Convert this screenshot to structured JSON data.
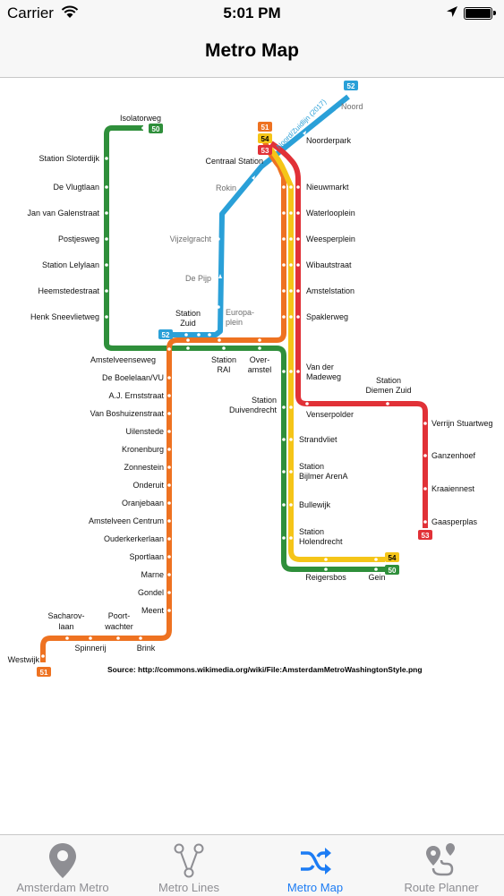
{
  "status_bar": {
    "carrier": "Carrier",
    "time": "5:01 PM",
    "battery_level": 1.0
  },
  "nav": {
    "title": "Metro Map"
  },
  "colors": {
    "line50": "#2f8f3b",
    "line51": "#ee7221",
    "line52": "#2aa0d8",
    "line53": "#e13137",
    "line54": "#f5c518",
    "active_tab": "#1c7cf4",
    "inactive_tab": "#8e8e93"
  },
  "map": {
    "source": "Source: http://commons.wikimedia.org/wiki/File:AmsterdamMetroWashingtonStyle.png",
    "construction_label": "Noord/Zuidlijn (2017)",
    "badges": {
      "b50": "50",
      "b51": "51",
      "b52": "52",
      "b53": "53",
      "b54": "54"
    },
    "stations": {
      "isolatorweg": "Isolatorweg",
      "sloterdijk": "Station Sloterdijk",
      "vlugtlaan": "De Vlugtlaan",
      "galenstraat": "Jan van Galenstraat",
      "postjesweg": "Postjesweg",
      "lelylaan": "Station Lelylaan",
      "heemstedestraat": "Heemstedestraat",
      "sneevlietweg": "Henk Sneevlietweg",
      "amstelveenseweg": "Amstelveenseweg",
      "boelelaan": "De Boelelaan/VU",
      "ernststraat": "A.J. Ernststraat",
      "boshuizenstraat": "Van Boshuizenstraat",
      "uilenstede": "Uilenstede",
      "kronenburg": "Kronenburg",
      "zonnestein": "Zonnestein",
      "onderuit": "Onderuit",
      "oranjebaan": "Oranjebaan",
      "amstelveen_centrum": "Amstelveen Centrum",
      "ouderkerkerlaan": "Ouderkerkerlaan",
      "sportlaan": "Sportlaan",
      "marne": "Marne",
      "gondel": "Gondel",
      "meent": "Meent",
      "sacharovlaan_1": "Sacharov-",
      "sacharovlaan_2": "laan",
      "poortwachter_1": "Poort-",
      "poortwachter_2": "wachter",
      "spinnerij": "Spinnerij",
      "brink": "Brink",
      "westwijk": "Westwijk",
      "noord": "Noord",
      "noorderpark": "Noorderpark",
      "centraal": "Centraal Station",
      "rokin": "Rokin",
      "vijzelgracht": "Vijzelgracht",
      "de_pijp": "De Pijp",
      "zuid_1": "Station",
      "zuid_2": "Zuid",
      "europaplein_1": "Europa-",
      "europaplein_2": "plein",
      "rai_1": "Station",
      "rai_2": "RAI",
      "overamstel_1": "Over-",
      "overamstel_2": "amstel",
      "nieuwmarkt": "Nieuwmarkt",
      "waterlooplein": "Waterlooplein",
      "weesperplein": "Weesperplein",
      "wibautstraat": "Wibautstraat",
      "amstelstation": "Amstelstation",
      "spaklerweg": "Spaklerweg",
      "madeweg_1": "Van der",
      "madeweg_2": "Madeweg",
      "duivendrecht_1": "Station",
      "duivendrecht_2": "Duivendrecht",
      "diemen_1": "Station",
      "diemen_2": "Diemen Zuid",
      "venserpolder": "Venserpolder",
      "verrijn": "Verrijn Stuartweg",
      "ganzenhoef": "Ganzenhoef",
      "kraaiennest": "Kraaiennest",
      "gaasperplas": "Gaasperplas",
      "strandvliet": "Strandvliet",
      "bijlmer_1": "Station",
      "bijlmer_2": "Bijlmer ArenA",
      "bullewijk": "Bullewijk",
      "holendrecht_1": "Station",
      "holendrecht_2": "Holendrecht",
      "reigersbos": "Reigersbos",
      "gein": "Gein"
    }
  },
  "tabs": [
    {
      "label": "Amsterdam Metro",
      "icon": "map-pin-icon"
    },
    {
      "label": "Metro Lines",
      "icon": "network-icon"
    },
    {
      "label": "Metro Map",
      "icon": "shuffle-icon"
    },
    {
      "label": "Route Planner",
      "icon": "route-icon"
    }
  ]
}
